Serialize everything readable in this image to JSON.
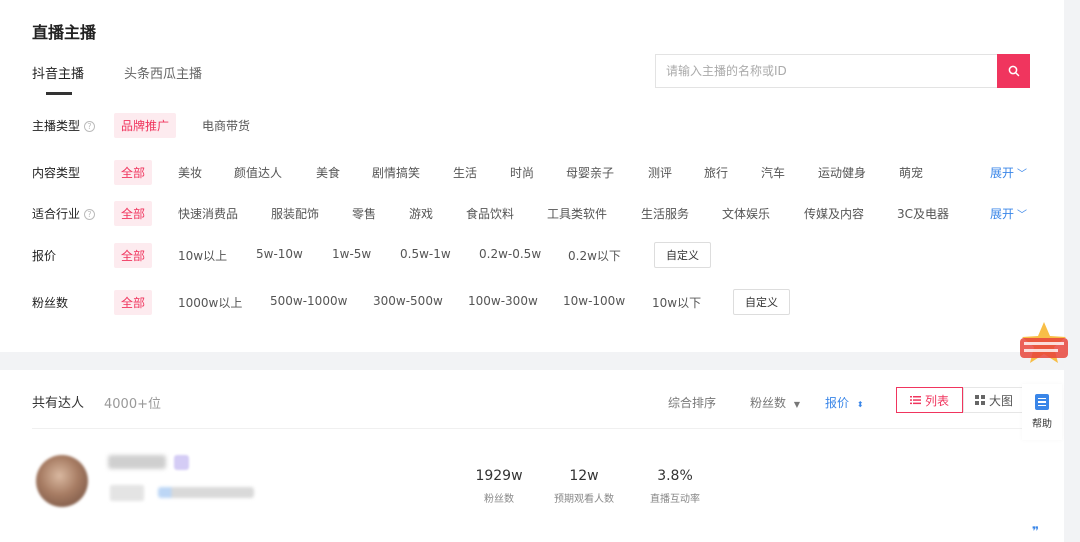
{
  "page_title": "直播主播",
  "tabs": [
    {
      "label": "抖音主播",
      "active": true
    },
    {
      "label": "头条西瓜主播",
      "active": false
    }
  ],
  "search": {
    "placeholder": "请输入主播的名称或ID"
  },
  "filters": {
    "streamer_type": {
      "label": "主播类型",
      "options": [
        "品牌推广",
        "电商带货"
      ],
      "selected": "品牌推广"
    },
    "content_type": {
      "label": "内容类型",
      "options": [
        "全部",
        "美妆",
        "颜值达人",
        "美食",
        "剧情搞笑",
        "生活",
        "时尚",
        "母婴亲子",
        "测评",
        "旅行",
        "汽车",
        "运动健身",
        "萌宠"
      ],
      "selected": "全部",
      "expand_label": "展开"
    },
    "industry": {
      "label": "适合行业",
      "options": [
        "全部",
        "快速消费品",
        "服装配饰",
        "零售",
        "游戏",
        "食品饮料",
        "工具类软件",
        "生活服务",
        "文体娱乐",
        "传媒及内容",
        "3C及电器"
      ],
      "selected": "全部",
      "expand_label": "展开"
    },
    "price": {
      "label": "报价",
      "options": [
        "全部",
        "10w以上",
        "5w-10w",
        "1w-5w",
        "0.5w-1w",
        "0.2w-0.5w",
        "0.2w以下"
      ],
      "selected": "全部",
      "custom_label": "自定义"
    },
    "fans": {
      "label": "粉丝数",
      "options": [
        "全部",
        "1000w以上",
        "500w-1000w",
        "300w-500w",
        "100w-300w",
        "10w-100w",
        "10w以下"
      ],
      "selected": "全部",
      "custom_label": "自定义"
    }
  },
  "results": {
    "total_label": "共有达人",
    "total_count": "4000+位",
    "sort": {
      "comprehensive": "综合排序",
      "fans": "粉丝数",
      "price": "报价"
    },
    "view": {
      "list": "列表",
      "grid": "大图"
    }
  },
  "streamer": {
    "stats": [
      {
        "value": "1929w",
        "label": "粉丝数"
      },
      {
        "value": "12w",
        "label": "预期观看人数"
      },
      {
        "value": "3.8%",
        "label": "直播互动率"
      }
    ]
  },
  "help": {
    "label": "帮助"
  },
  "colors": {
    "accent": "#f0355e",
    "link": "#3a86e8"
  },
  "icons": {
    "search": "search-icon",
    "help": "help-doc-icon",
    "list": "list-icon",
    "grid": "grid-icon"
  }
}
